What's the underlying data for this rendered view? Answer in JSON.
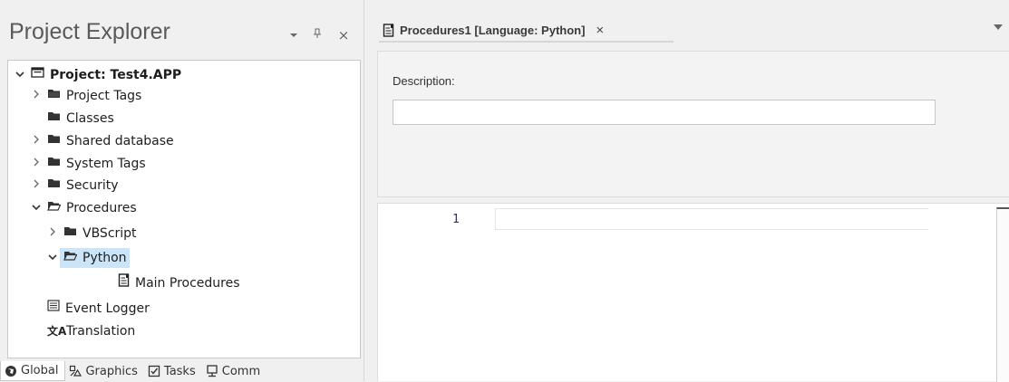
{
  "explorer": {
    "title": "Project Explorer",
    "header_buttons": {
      "dropdown": "▾",
      "pin": "ᵖ",
      "close": "×"
    },
    "tree": [
      {
        "label": "Project: Test4.APP",
        "icon": "project-icon",
        "expanded": true,
        "bold": true
      },
      {
        "label": "Project Tags",
        "icon": "folder-icon",
        "expandable": true
      },
      {
        "label": "Classes",
        "icon": "folder-icon"
      },
      {
        "label": "Shared database",
        "icon": "folder-icon",
        "expandable": true
      },
      {
        "label": "System Tags",
        "icon": "folder-icon",
        "expandable": true
      },
      {
        "label": "Security",
        "icon": "folder-icon",
        "expandable": true
      },
      {
        "label": "Procedures",
        "icon": "folder-open-icon",
        "expanded": true
      },
      {
        "label": "VBScript",
        "icon": "folder-icon",
        "expandable": true
      },
      {
        "label": "Python",
        "icon": "folder-open-icon",
        "expanded": true,
        "selected": true
      },
      {
        "label": "Main Procedures",
        "icon": "script-document-icon"
      },
      {
        "label": "Event Logger",
        "icon": "list-icon"
      },
      {
        "label": "Translation",
        "icon": "translate-icon"
      }
    ],
    "bottom_tabs": [
      {
        "label": "Global",
        "icon": "globe-icon",
        "active": true
      },
      {
        "label": "Graphics",
        "icon": "graphics-icon"
      },
      {
        "label": "Tasks",
        "icon": "tasks-icon"
      },
      {
        "label": "Comm",
        "icon": "comm-icon"
      }
    ]
  },
  "editor": {
    "tab": {
      "label": "Procedures1 [Language: Python]",
      "icon": "script-document-icon",
      "close": "×"
    },
    "tab_dropdown": "▼",
    "description": {
      "label": "Description:",
      "value": ""
    },
    "code": {
      "line_number": "1"
    }
  },
  "colors": {
    "panel_bg": "#f0f0f0",
    "selection": "#cce4f7",
    "line_number": "#2b2b8a"
  }
}
